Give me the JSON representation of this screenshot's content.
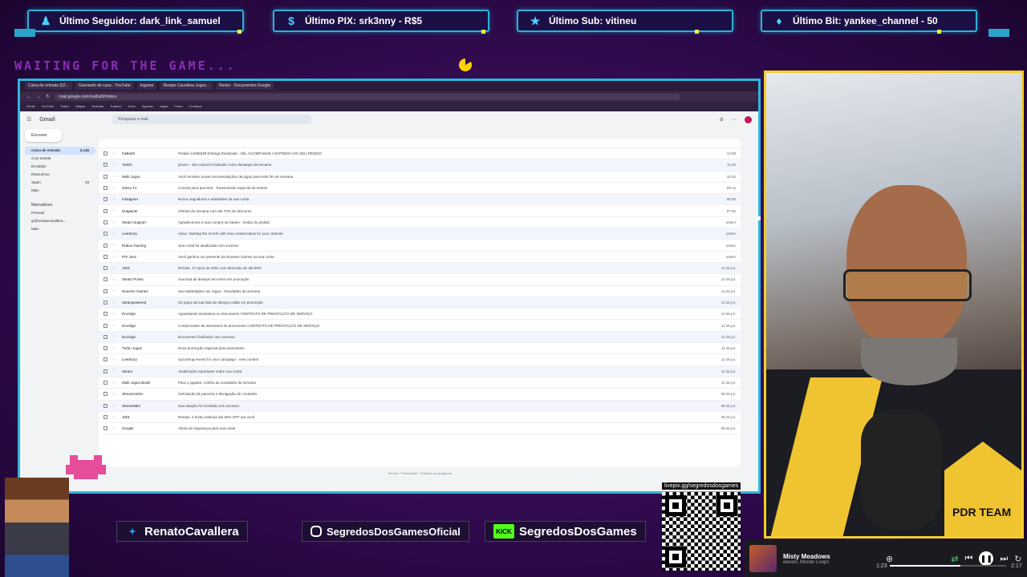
{
  "alerts": [
    {
      "icon": "person-icon",
      "text": "Último Seguidor: dark_link_samuel"
    },
    {
      "icon": "dollar-icon",
      "text": "Último PIX: srk3nny - R$5"
    },
    {
      "icon": "star-icon",
      "text": "Último Sub: vitineu"
    },
    {
      "icon": "gem-icon",
      "text": "Último Bit: yankee_channel - 50"
    }
  ],
  "waiting_text": "WAITING FOR THE GAME...",
  "browser": {
    "tabs": [
      "Caixa de entrada (52...",
      "Gravando de casa - YouTube",
      "Ingame",
      "Renato Cavallera Jogos...",
      "Nooks - Documentos Google"
    ],
    "url": "mail.google.com/mail/u/0/#inbox",
    "bookmarks": [
      "Gmail",
      "YouTube",
      "Twitch",
      "Mapas",
      "Notícias",
      "Traduzir",
      "Drive",
      "Agenda",
      "Jogos",
      "Fotos",
      "Contatos"
    ]
  },
  "gmail": {
    "logo": "Gmail",
    "search_placeholder": "Pesquisar e-mail",
    "compose_label": "Escrever",
    "nav": [
      "Caixa de entrada",
      "Com estrela",
      "Enviados",
      "Rascunhos",
      "Spam",
      "Mais"
    ],
    "nav_counts": [
      "2.145",
      "",
      "",
      "",
      "28",
      ""
    ],
    "labels_header": "Marcadores",
    "labels": [
      "Pessoal",
      "gr@renatocavallera...",
      "Mais"
    ],
    "emails": [
      {
        "sender": "KaBuM!",
        "subject": "Pedido 14308329 Entrega Realizada - Olá, ACOMPANHE A ENTREGA DO SEU PEDIDO",
        "date": "12:08"
      },
      {
        "sender": "Twitch",
        "subject": "promo - Seu canal foi indicado como destaque da semana",
        "date": "11:20"
      },
      {
        "sender": "Multi Jogos",
        "subject": "Você recebeu novas recomendações de jogos para este fim de semana",
        "date": "10:45"
      },
      {
        "sender": "Gleva TV",
        "subject": "Convite para parceria - Transmissão especial do evento",
        "date": "09:12"
      },
      {
        "sender": "Instagram",
        "subject": "Novos seguidores e atividades da sua conta",
        "date": "08:30"
      },
      {
        "sender": "Dotgamer",
        "subject": "Ofertas da semana com até 70% de desconto",
        "date": "07:55"
      },
      {
        "sender": "Steam Support",
        "subject": "Agradecemos a sua compra na Steam - recibo do pedido",
        "date": "ontem"
      },
      {
        "sender": "LiveStory",
        "subject": "Aviso: Starting the month with new content ideas for your channel",
        "date": "ontem"
      },
      {
        "sender": "Robux Gaming",
        "subject": "Sua conta foi atualizada com sucesso",
        "date": "ontem"
      },
      {
        "sender": "PIX Jovs",
        "subject": "Você ganhou um presente da Nuuvem Games na sua conta",
        "date": "ontem"
      },
      {
        "sender": "1001",
        "subject": "Renato, 17 anos de 1001 com desconto de até 60%",
        "date": "14 de jul."
      },
      {
        "sender": "Steam Points",
        "subject": "Sua lista de desejos tem itens em promoção",
        "date": "14 de jul."
      },
      {
        "sender": "Nuuvem Games",
        "subject": "Seu Marketplace de Jogos - Novidades da semana",
        "date": "13 de jul."
      },
      {
        "sender": "Steampowered",
        "subject": "Os jogos da sua lista de desejos estão em promoção",
        "date": "13 de jul."
      },
      {
        "sender": "DocSign",
        "subject": "Aguardando assinatura no documento CONTRATO DE PRESTAÇÃO DE SERVIÇO",
        "date": "12 de jul."
      },
      {
        "sender": "DocSign",
        "subject": "Comprovante de assinatura do documento CONTRATO DE PRESTAÇÃO DE SERVIÇO",
        "date": "12 de jul."
      },
      {
        "sender": "DocSign",
        "subject": "Documento finalizado com sucesso",
        "date": "12 de jul."
      },
      {
        "sender": "Turbo Jogos",
        "subject": "Nova promoção especial para assinantes",
        "date": "11 de jul."
      },
      {
        "sender": "LiveStory",
        "subject": "Upcoming events for your campaign - new content",
        "date": "11 de jul."
      },
      {
        "sender": "Steam",
        "subject": "Atualização importante sobre sua conta",
        "date": "10 de jul."
      },
      {
        "sender": "Multi Jogos Brasil",
        "subject": "Para o jogador: confira as novidades da semana",
        "date": "10 de jul."
      },
      {
        "sender": "Streamvisión",
        "subject": "Solicitação de parceria e divulgação de conteúdo",
        "date": "09 de jul."
      },
      {
        "sender": "Streamlabs",
        "subject": "Sua doação foi recebida com sucesso",
        "date": "09 de jul."
      },
      {
        "sender": "1001",
        "subject": "Renato, a festa continua até 60% OFF pra você",
        "date": "08 de jul."
      },
      {
        "sender": "Google",
        "subject": "Alerta de segurança para sua conta",
        "date": "08 de jul."
      }
    ],
    "footer": "Termos · Privacidade · Políticas do programa"
  },
  "team_text": "PDR TEAM",
  "social": {
    "twitter": "RenatoCavallera",
    "instagram": "SegredosDosGamesOficial",
    "kick_badge": "KICK",
    "kick": "SegredosDosGames"
  },
  "qr_url": "livepix.gg/segredosdosgames",
  "player": {
    "title": "Misty Meadows",
    "artist": "eleven, Mondo Loops",
    "elapsed": "1:23",
    "duration": "2:17",
    "progress": 0.61
  },
  "colors": {
    "accent": "#2eb6dd",
    "frame_yellow": "#f3cf2a",
    "background": "#3a0d5c"
  }
}
